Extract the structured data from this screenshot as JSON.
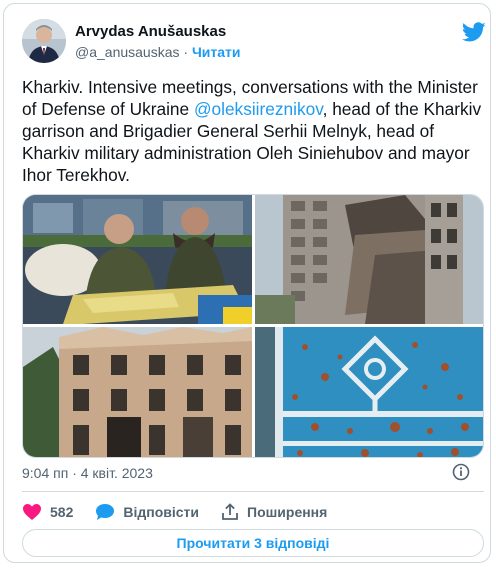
{
  "author": {
    "name": "Arvydas Anušauskas",
    "handle": "@a_anusauskas",
    "separator": " · ",
    "follow_label": "Читати"
  },
  "tweet": {
    "text_before": "Kharkiv. Intensive meetings, conversations with the Minister of Defense of Ukraine ",
    "mention": "@oleksiireznikov",
    "text_after": ", head of the Kharkiv garrison and Brigadier General Serhii Melnyk, head of Kharkiv military administration Oleh Siniehubov and mayor Ihor Terekhov."
  },
  "timestamp": "9:04 пп · 4 квіт. 2023",
  "actions": {
    "like_count": "582",
    "reply_label": "Відповісти",
    "share_label": "Поширення"
  },
  "read_replies_label": "Прочитати 3 відповіді",
  "colors": {
    "accent": "#1d9bf0",
    "heart": "#f91880",
    "text_secondary": "#536471",
    "border": "#cfd9de"
  },
  "icons": [
    "twitter-bird-icon",
    "heart-icon",
    "reply-bubble-icon",
    "share-icon",
    "info-icon"
  ]
}
